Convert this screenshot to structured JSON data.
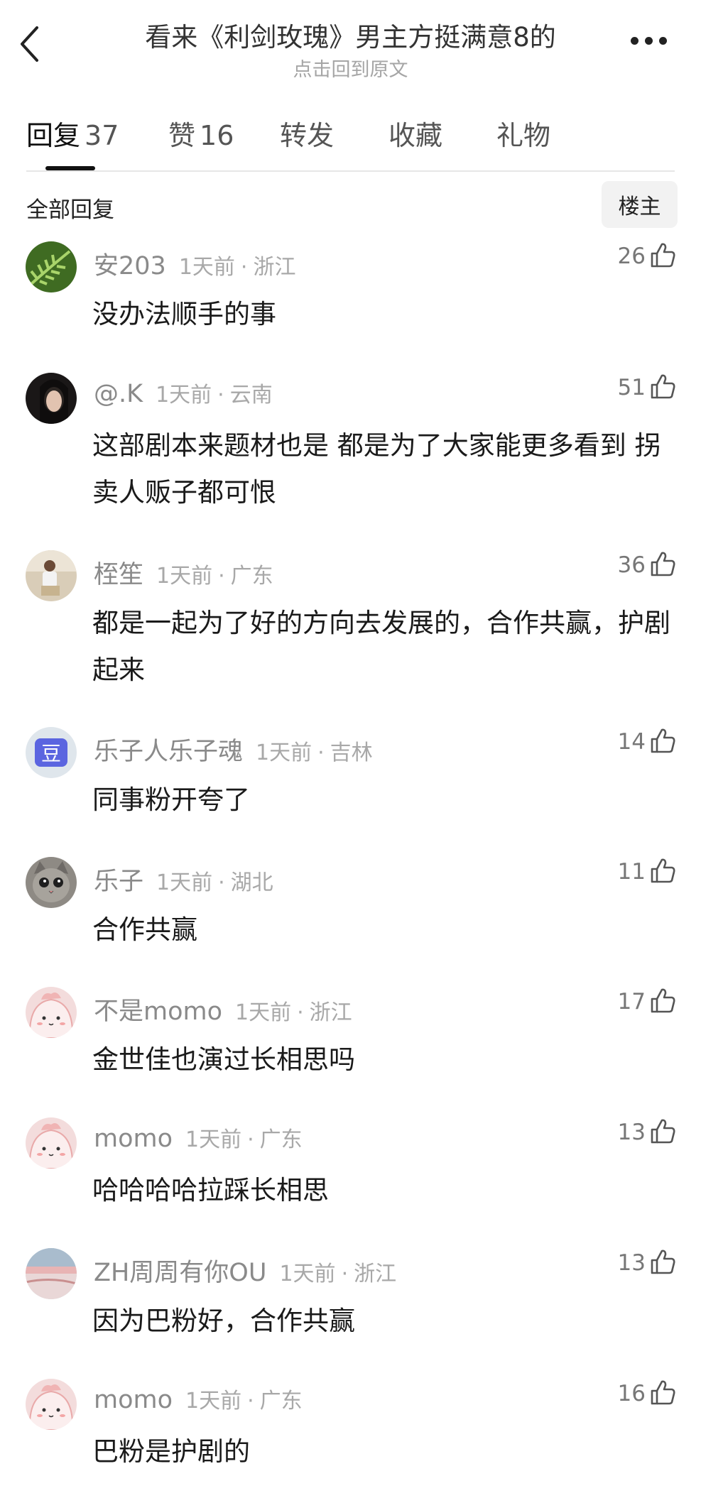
{
  "header": {
    "title": "看来《利剑玫瑰》男主方挺满意8的",
    "subtitle": "点击回到原文"
  },
  "tabs": [
    {
      "label": "回复",
      "count": "37"
    },
    {
      "label": "赞",
      "count": "16"
    },
    {
      "label": "转发",
      "count": ""
    },
    {
      "label": "收藏",
      "count": ""
    },
    {
      "label": "礼物",
      "count": ""
    }
  ],
  "section": {
    "title": "全部回复",
    "op_filter": "楼主"
  },
  "comments": [
    {
      "name": "安203",
      "time": "1天前",
      "sep": "·",
      "region": "浙江",
      "likes": "26",
      "text": "没办法顺手的事",
      "avatar": "fern-avatar"
    },
    {
      "name": "@.K",
      "time": "1天前",
      "sep": "·",
      "region": "云南",
      "likes": "51",
      "text": "这部剧本来题材也是 都是为了大家能更多看到 拐卖人贩子都可恨",
      "avatar": "girl-avatar"
    },
    {
      "name": "桎笙",
      "time": "1天前",
      "sep": "·",
      "region": "广东",
      "likes": "36",
      "text": "都是一起为了好的方向去发展的，合作共赢，护剧起来",
      "avatar": "person-avatar"
    },
    {
      "name": "乐子人乐子魂",
      "time": "1天前",
      "sep": "·",
      "region": "吉林",
      "likes": "14",
      "text": "同事粉开夸了",
      "avatar": "douban-avatar"
    },
    {
      "name": "乐子",
      "time": "1天前",
      "sep": "·",
      "region": "湖北",
      "likes": "11",
      "text": "合作共赢",
      "avatar": "cat-avatar"
    },
    {
      "name": "不是momo",
      "time": "1天前",
      "sep": "·",
      "region": "浙江",
      "likes": "17",
      "text": "金世佳也演过长相思吗",
      "avatar": "momo-avatar"
    },
    {
      "name": "momo",
      "time": "1天前",
      "sep": "·",
      "region": "广东",
      "likes": "13",
      "text": "哈哈哈哈拉踩长相思",
      "avatar": "momo-avatar"
    },
    {
      "name": "ZH周周有你OU",
      "time": "1天前",
      "sep": "·",
      "region": "浙江",
      "likes": "13",
      "text": "因为巴粉好，合作共赢",
      "avatar": "landscape-avatar"
    },
    {
      "name": "momo",
      "time": "1天前",
      "sep": "·",
      "region": "广东",
      "likes": "16",
      "text": "巴粉是护剧的",
      "avatar": "momo-avatar"
    }
  ],
  "avatar_glyphs": {
    "douban": "豆"
  }
}
